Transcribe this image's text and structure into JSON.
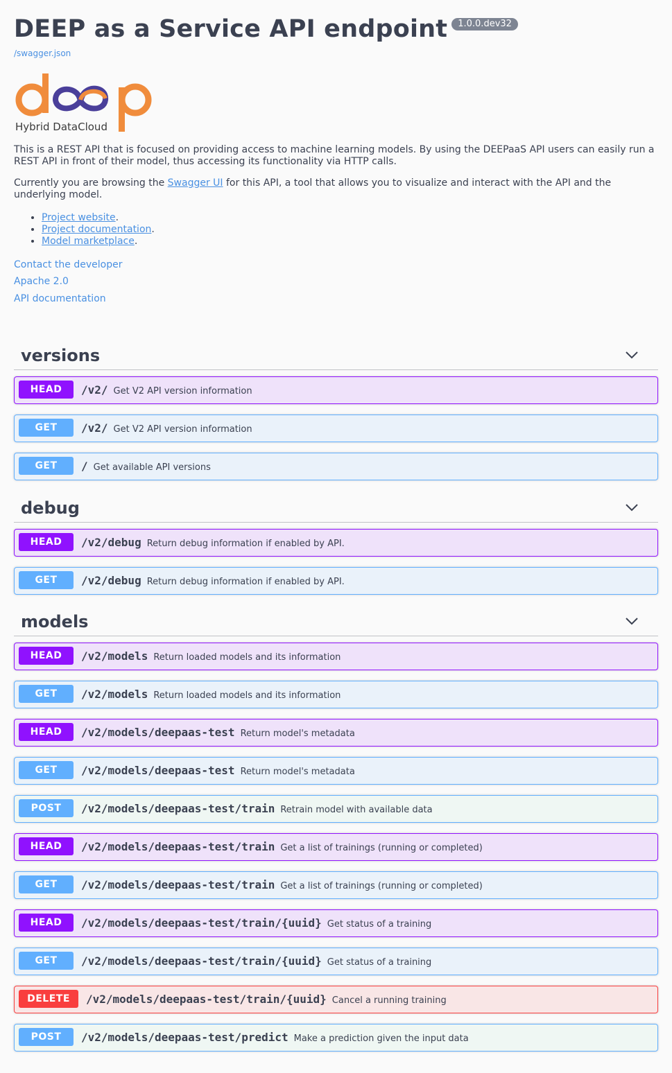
{
  "header": {
    "title": "DEEP as a Service API endpoint",
    "version": "1.0.0.dev32",
    "swagger_link": "/swagger.json"
  },
  "logo": {
    "word": "deep",
    "subtitle": "Hybrid DataCloud",
    "colors": {
      "orange": "#f08c3c",
      "purple": "#4a3f9a"
    }
  },
  "description": {
    "p1": "This is a REST API that is focused on providing access to machine learning models. By using the DEEPaaS API users can easily run a REST API in front of their model, thus accessing its functionality via HTTP calls.",
    "p2_before": "Currently you are browsing the ",
    "p2_link": "Swagger UI",
    "p2_after": " for this API, a tool that allows you to visualize and interact with the API and the underlying model.",
    "bullets": [
      {
        "label": "Project website"
      },
      {
        "label": "Project documentation"
      },
      {
        "label": "Model marketplace"
      }
    ],
    "bullet_suffix": "."
  },
  "info_links": {
    "contact": "Contact the developer",
    "license": "Apache 2.0",
    "docs": "API documentation"
  },
  "tags": [
    {
      "name": "versions",
      "operations": [
        {
          "method": "HEAD",
          "path": "/v2/",
          "summary": "Get V2 API version information"
        },
        {
          "method": "GET",
          "path": "/v2/",
          "summary": "Get V2 API version information"
        },
        {
          "method": "GET",
          "path": "/",
          "summary": "Get available API versions"
        }
      ]
    },
    {
      "name": "debug",
      "operations": [
        {
          "method": "HEAD",
          "path": "/v2/debug",
          "summary": "Return debug information if enabled by API."
        },
        {
          "method": "GET",
          "path": "/v2/debug",
          "summary": "Return debug information if enabled by API."
        }
      ]
    },
    {
      "name": "models",
      "operations": [
        {
          "method": "HEAD",
          "path": "/v2/models",
          "summary": "Return loaded models and its information"
        },
        {
          "method": "GET",
          "path": "/v2/models",
          "summary": "Return loaded models and its information"
        },
        {
          "method": "HEAD",
          "path": "/v2/models/deepaas-test",
          "summary": "Return model's metadata"
        },
        {
          "method": "GET",
          "path": "/v2/models/deepaas-test",
          "summary": "Return model's metadata"
        },
        {
          "method": "POST",
          "path": "/v2/models/deepaas-test/train",
          "summary": "Retrain model with available data"
        },
        {
          "method": "HEAD",
          "path": "/v2/models/deepaas-test/train",
          "summary": "Get a list of trainings (running or completed)"
        },
        {
          "method": "GET",
          "path": "/v2/models/deepaas-test/train",
          "summary": "Get a list of trainings (running or completed)"
        },
        {
          "method": "HEAD",
          "path": "/v2/models/deepaas-test/train/{uuid}",
          "summary": "Get status of a training"
        },
        {
          "method": "GET",
          "path": "/v2/models/deepaas-test/train/{uuid}",
          "summary": "Get status of a training"
        },
        {
          "method": "DELETE",
          "path": "/v2/models/deepaas-test/train/{uuid}",
          "summary": "Cancel a running training"
        },
        {
          "method": "POST",
          "path": "/v2/models/deepaas-test/predict",
          "summary": "Make a prediction given the input data"
        }
      ]
    }
  ],
  "colors": {
    "head": "#9012fe",
    "get": "#61affe",
    "post": "#61affe",
    "delete": "#f93e3e",
    "link": "#4990e2"
  }
}
